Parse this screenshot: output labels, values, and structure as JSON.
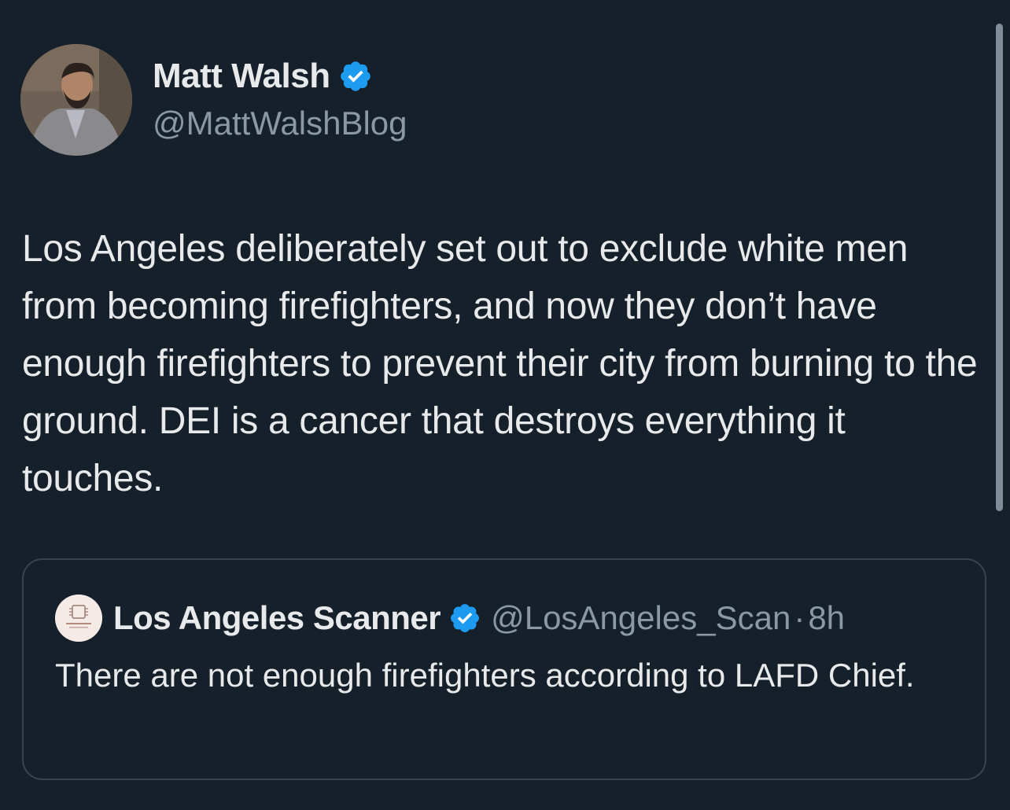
{
  "tweet": {
    "author_name": "Matt Walsh",
    "author_handle": "@MattWalshBlog",
    "text": "Los Angeles deliberately set out to exclude white men from becoming firefighters, and now they don’t have enough firefighters to prevent their city from burning to the ground. DEI is a cancer that destroys everything it touches."
  },
  "quoted_tweet": {
    "author_name": "Los Angeles Scanner",
    "author_handle": "@LosAngeles_Scan",
    "separator": "·",
    "time": "8h",
    "text": "There are not enough firefighters according to LAFD Chief."
  },
  "colors": {
    "background": "#15202b",
    "text_primary": "#e7e9ea",
    "text_secondary": "#8b98a5",
    "verified_blue": "#1d9bf0",
    "border": "#38444d"
  },
  "icons": {
    "verified": "verified-badge-icon"
  }
}
